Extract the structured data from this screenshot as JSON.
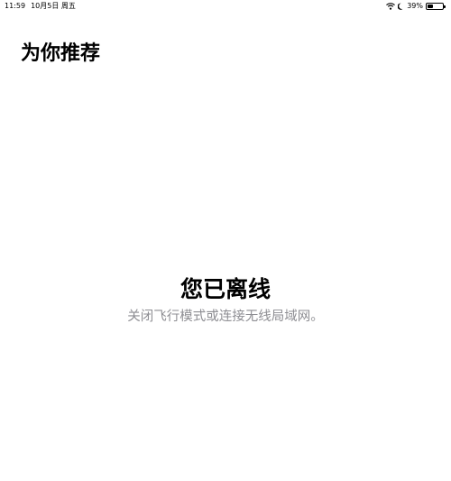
{
  "status_bar": {
    "time": "11:59",
    "date": "10月5日 周五",
    "battery_percent": "39%",
    "battery_level": 0.39
  },
  "header": {
    "title": "为你推荐"
  },
  "offline": {
    "title": "您已离线",
    "message": "关闭飞行模式或连接无线局域网。"
  }
}
